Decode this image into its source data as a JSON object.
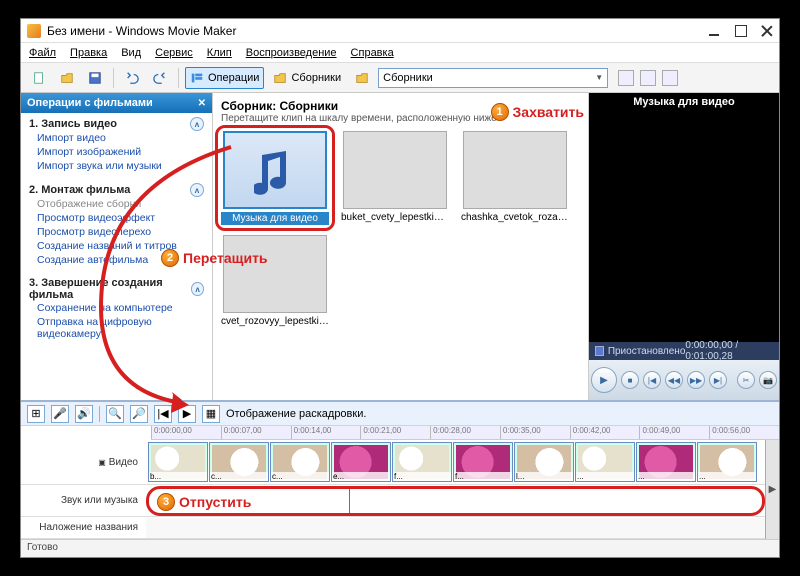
{
  "window": {
    "title": "Без имени - Windows Movie Maker"
  },
  "menus": {
    "file": "Файл",
    "edit": "Правка",
    "view": "Вид",
    "service": "Сервис",
    "clip": "Клип",
    "play": "Воспроизведение",
    "help": "Справка"
  },
  "toolbar": {
    "operations": "Операции",
    "collections": "Сборники",
    "dropdown": "Сборники"
  },
  "taskpane": {
    "title": "Операции с фильмами",
    "g1": {
      "title": "1. Запись видео",
      "links": [
        "Импорт видео",
        "Импорт изображений",
        "Импорт звука или музыки"
      ]
    },
    "g2": {
      "title": "2. Монтаж фильма",
      "gray": "Отображение сборни",
      "links": [
        "Просмотр видеоэффект",
        "Просмотр видеоперехо",
        "Создание названий и титров",
        "Создание автофильма"
      ]
    },
    "g3": {
      "title": "3. Завершение создания фильма",
      "links": [
        "Сохранение на компьютере",
        "Отправка на цифровую видеокамеру"
      ]
    }
  },
  "collection": {
    "title": "Сборник: Сборники",
    "desc": "Перетащите клип на шкалу времени, расположенную ниже",
    "items": [
      {
        "cap": "Музыка для видео",
        "kind": "audio",
        "selected": true
      },
      {
        "cap": "buket_cvety_lepestki_be...",
        "kind": "flower1"
      },
      {
        "cap": "chashka_cvetok_roza_8...",
        "kind": "flower2"
      },
      {
        "cap": "cvet_rozovyy_lepestki_r...",
        "kind": "flower3"
      }
    ]
  },
  "preview": {
    "title": "Музыка для видео",
    "status": "Приостановлено",
    "time": "0:00:00,00 / 0:01:00,28"
  },
  "timeline": {
    "toolbar_label": "Отображение раскадровки.",
    "ruler": [
      "0:00:00,00",
      "0:00:07,00",
      "0:00:14,00",
      "0:00:21,00",
      "0:00:28,00",
      "0:00:35,00",
      "0:00:42,00",
      "0:00:49,00",
      "0:00:56,00"
    ],
    "tracks": {
      "video": "Видео",
      "audio": "Звук или музыка",
      "title": "Наложение названия"
    },
    "clips": [
      "b...",
      "c...",
      "c...",
      "e...",
      "f...",
      "f...",
      "l...",
      "...",
      "...",
      "..."
    ]
  },
  "annotations": {
    "grab": "Захватить",
    "drag": "Перетащить",
    "drop": "Отпустить"
  },
  "status": "Готово"
}
